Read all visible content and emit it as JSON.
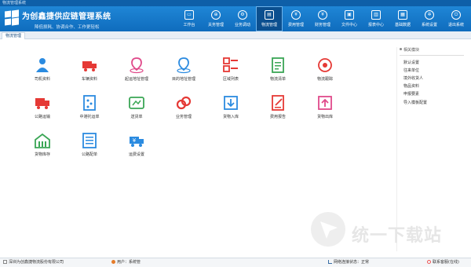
{
  "titlebar": {
    "text": "物流管理系统"
  },
  "header": {
    "title": "为创鑫捷供应链管理系统",
    "slogan": "降低损耗、协调合作、工作更轻松"
  },
  "nav": [
    {
      "label": "工作台",
      "icon": "monitor-icon",
      "glyph": "▭"
    },
    {
      "label": "关务管理",
      "icon": "customs-icon",
      "glyph": "⊕"
    },
    {
      "label": "业务调动",
      "icon": "business-icon",
      "glyph": "⚙"
    },
    {
      "label": "物流管理",
      "icon": "truck-icon",
      "glyph": "▤",
      "active": true
    },
    {
      "label": "费用管理",
      "icon": "yen-icon",
      "glyph": "¥"
    },
    {
      "label": "财务管理",
      "icon": "finance-icon",
      "glyph": "¥"
    },
    {
      "label": "文件中心",
      "icon": "folder-icon",
      "glyph": "▣"
    },
    {
      "label": "报表中心",
      "icon": "report-icon",
      "glyph": "▥"
    },
    {
      "label": "基础数据",
      "icon": "database-icon",
      "glyph": "▦"
    },
    {
      "label": "系统设置",
      "icon": "gear-icon",
      "glyph": "✲"
    },
    {
      "label": "退出系统",
      "icon": "power-icon",
      "glyph": "⏻"
    }
  ],
  "tabs": [
    {
      "label": "物流管理"
    }
  ],
  "tiles": [
    {
      "label": "司机资料",
      "icon": "driver-icon",
      "color": "#2b8be0"
    },
    {
      "label": "车辆资料",
      "icon": "vehicle-icon",
      "color": "#e53935"
    },
    {
      "label": "起运地址管理",
      "icon": "pickup-location-icon",
      "color": "#e04a8a"
    },
    {
      "label": "目的地址管理",
      "icon": "destination-location-icon",
      "color": "#2b8be0"
    },
    {
      "label": "区域列表",
      "icon": "region-list-icon",
      "color": "#e53935"
    },
    {
      "label": "物流清单",
      "icon": "logistics-list-icon",
      "color": "#3aa655"
    },
    {
      "label": "物流跟踪",
      "icon": "tracking-icon",
      "color": "#e53935"
    },
    {
      "label": "公路运输",
      "icon": "road-transport-icon",
      "color": "#e53935"
    },
    {
      "label": "中港托运单",
      "icon": "consignment-icon",
      "color": "#2b8be0"
    },
    {
      "label": "送货单",
      "icon": "delivery-note-icon",
      "color": "#3aa655"
    },
    {
      "label": "业务管理",
      "icon": "business-link-icon",
      "color": "#e53935"
    },
    {
      "label": "货物入库",
      "icon": "stock-in-icon",
      "color": "#2b8be0"
    },
    {
      "label": "费用报告",
      "icon": "expense-report-icon",
      "color": "#e53935"
    },
    {
      "label": "货物出库",
      "icon": "stock-out-icon",
      "color": "#e04a8a"
    },
    {
      "label": "货物库存",
      "icon": "inventory-icon",
      "color": "#3aa655"
    },
    {
      "label": "公路配单",
      "icon": "road-dispatch-icon",
      "color": "#2b8be0"
    },
    {
      "label": "运费设置",
      "icon": "freight-setting-icon",
      "color": "#2b8be0"
    }
  ],
  "side": {
    "title": "相关模块",
    "items": [
      "默认设置",
      "往来单位",
      "境外收货人",
      "物品资料",
      "申报要素",
      "导入模板配置"
    ]
  },
  "status": {
    "company": "深圳为创鑫捷物流股份有限公司",
    "user": "用户：系统管",
    "network": "网络连接状态：正常",
    "contact": "联系客服(在线)"
  },
  "watermark": {
    "text": "统一下载站"
  }
}
